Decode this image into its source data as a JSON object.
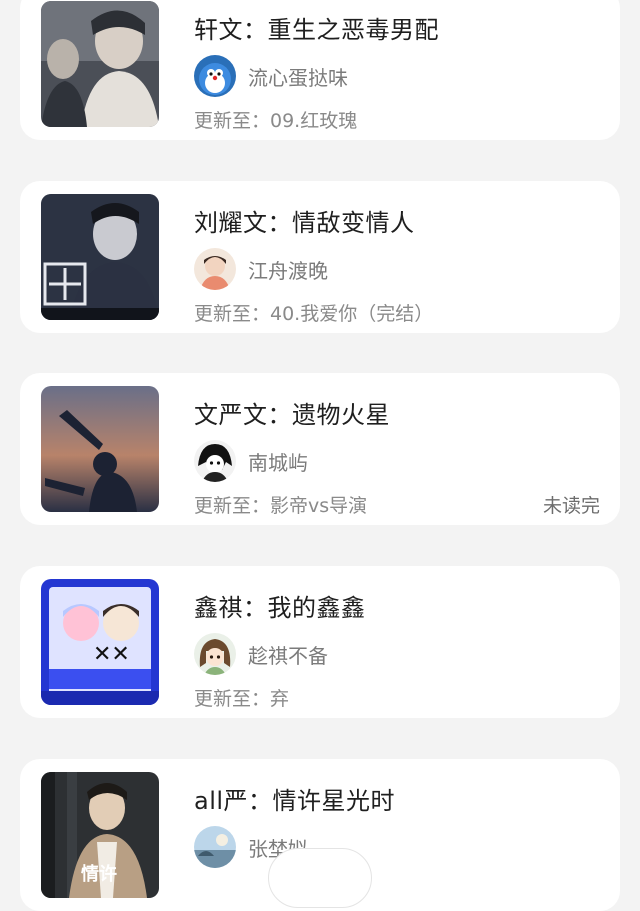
{
  "books": [
    {
      "title": "轩文：重生之恶毒男配",
      "author": "流心蛋挞味",
      "update": "更新至：09.红玫瑰",
      "status": "",
      "cover_colors": [
        "#3a3e45",
        "#8d8f95",
        "#d9d4cf"
      ],
      "avatar_icon": "cartoon-cat-avatar-icon"
    },
    {
      "title": "刘耀文：情敌变情人",
      "author": "江舟渡晚",
      "update": "更新至：40.我爱你（完结）",
      "status": "",
      "cover_colors": [
        "#1e2230",
        "#4a5266",
        "#c9ccd6"
      ],
      "avatar_icon": "person-avatar-icon"
    },
    {
      "title": "文严文：遗物火星",
      "author": "南城屿",
      "update": "更新至：影帝vs导演",
      "status": "未读完",
      "cover_colors": [
        "#5a5e75",
        "#b47c63",
        "#232838"
      ],
      "avatar_icon": "anime-avatar-icon"
    },
    {
      "title": "鑫祺：我的鑫鑫",
      "author": "趁祺不备",
      "update": "更新至：弃",
      "status": "",
      "cover_colors": [
        "#2a3bd6",
        "#e6e9ff",
        "#ffb7cf"
      ],
      "avatar_icon": "anime-girl-avatar-icon"
    },
    {
      "title": "all严：情许星光时",
      "author": "张埜姒",
      "update": "",
      "status": "",
      "cover_colors": [
        "#2e3133",
        "#b8a48a",
        "#e8e4dc"
      ],
      "avatar_icon": "landscape-avatar-icon"
    }
  ],
  "theme": {
    "accent": "#38b6f0",
    "card_bg": "#ffffff",
    "page_bg": "#f3f3f3"
  }
}
